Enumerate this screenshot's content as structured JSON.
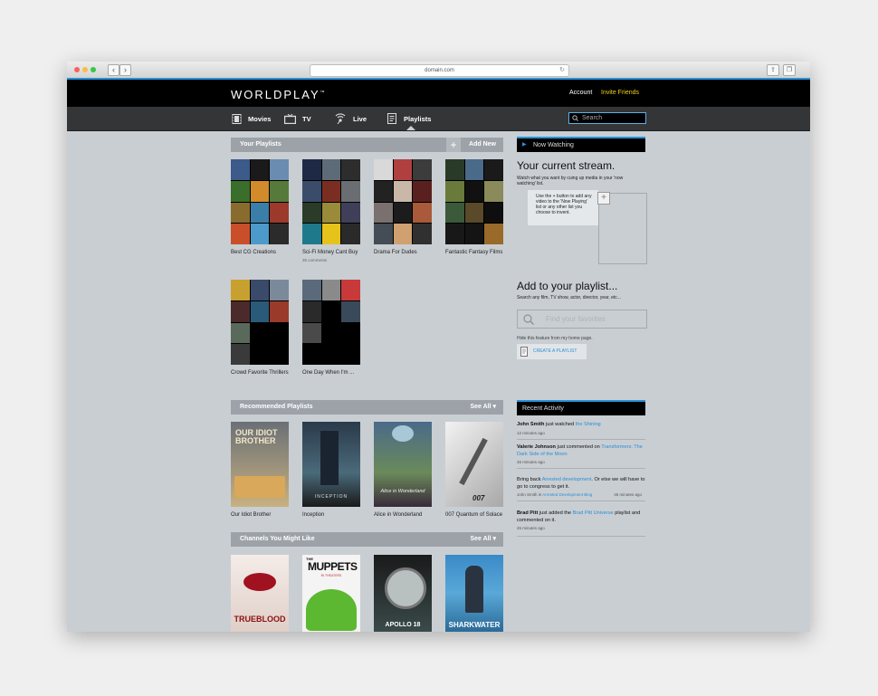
{
  "browser": {
    "url": "domain.com",
    "back_icon": "chevron-left-icon",
    "forward_icon": "chevron-right-icon"
  },
  "header": {
    "logo": "WORLDPLAY",
    "logo_mark": "™",
    "account": "Account",
    "invite": "Invite Friends",
    "accent_color": "#2b91d6",
    "invite_color": "#f2d21b"
  },
  "nav": {
    "items": [
      {
        "label": "Movies",
        "icon": "film-icon"
      },
      {
        "label": "TV",
        "icon": "tv-icon"
      },
      {
        "label": "Live",
        "icon": "broadcast-icon"
      },
      {
        "label": "Playlists",
        "icon": "playlist-icon"
      }
    ],
    "search_placeholder": "Search"
  },
  "your_playlists": {
    "title": "Your Playlists",
    "add_plus": "+",
    "add_new": "Add New",
    "items": [
      {
        "title": "Best CG Creations"
      },
      {
        "title": "Sci-Fi Money Cant Buy",
        "meta": "35 comments"
      },
      {
        "title": "Drama For Dudes"
      },
      {
        "title": "Fantastic Fantasy Films"
      },
      {
        "title": "Crowd Favorite Thrillers"
      },
      {
        "title": "One Day When I'm ..."
      }
    ]
  },
  "recommended": {
    "title": "Recommended Playlists",
    "see_all": "See All",
    "items": [
      {
        "title": "Our Idiot Brother",
        "poster_text": "OUR IDIOT BROTHER"
      },
      {
        "title": "Inception",
        "poster_text": "INCEPTION"
      },
      {
        "title": "Alice in Wonderland",
        "poster_text": "Alice in Wonderland"
      },
      {
        "title": "007 Quantum of Solace",
        "poster_text": "007"
      }
    ]
  },
  "channels": {
    "title": "Channels You Might Like",
    "see_all": "See All",
    "items": [
      {
        "poster_text": "TRUEBLOOD"
      },
      {
        "poster_text": "MUPPETS",
        "poster_text_top": "THE",
        "poster_sub": "IN THEATERS"
      },
      {
        "poster_text": "APOLLO 18"
      },
      {
        "poster_text": "SHARKWATER"
      }
    ]
  },
  "now_watching": {
    "header": "Now Watching",
    "title": "Your current stream.",
    "desc": "Watch what you want by cuing up media in your 'now watching' list.",
    "tooltip": "Use the + button to add any video to the 'Now Playing' list or any other list you choose to invent.",
    "plus": "+"
  },
  "add_playlist": {
    "title": "Add to your playlist...",
    "desc": "Search any film, TV show, actor, director, year, etc...",
    "placeholder": "Find your favorites",
    "hide_note": "Hide this feature from my home page.",
    "create_label": "CREATE A PLAYLIST"
  },
  "recent_activity": {
    "header": "Recent Activity",
    "items": [
      {
        "user": "John Smith",
        "pre": " just watched ",
        "link": "the Shining",
        "post": "",
        "time": "12 minutes ago"
      },
      {
        "user": "Valerie Johnson",
        "pre": " just commented on ",
        "link": "Transformers: The Dark Side of the Moon",
        "post": "",
        "time": "45 minutes ago"
      },
      {
        "user": "",
        "pre": "Bring back ",
        "link": "Arrested development",
        "post": ". Or else we will have to go to congress to get it.",
        "meta_user": "John Smith",
        "meta_in": " in ",
        "meta_link": "Arrested Development Blog",
        "time": "45 minutes ago"
      },
      {
        "user": "Brad Pitt",
        "pre": " just added the ",
        "link": "Brad Pitt Universe",
        "post": " playlist and commented on it.",
        "time": "45 minutes ago"
      }
    ]
  }
}
